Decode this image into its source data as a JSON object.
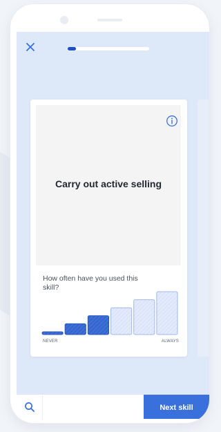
{
  "header": {
    "close_icon": "close-icon",
    "progress_fraction": 0.1
  },
  "card": {
    "info_icon": "info-icon",
    "skill_title": "Carry out active selling",
    "question": "How often have you used this skill?",
    "scale": {
      "levels": 6,
      "selected_level": 3,
      "min_label": "NEVER",
      "max_label": "ALWAYS"
    }
  },
  "bottom_bar": {
    "search_icon": "search-icon",
    "next_label": "Next skill"
  },
  "colors": {
    "accent": "#3a70dc",
    "accent_dark": "#1f4fc2",
    "screen_bg": "#dde8f8",
    "bar_unselected": "#dbe6fb"
  }
}
